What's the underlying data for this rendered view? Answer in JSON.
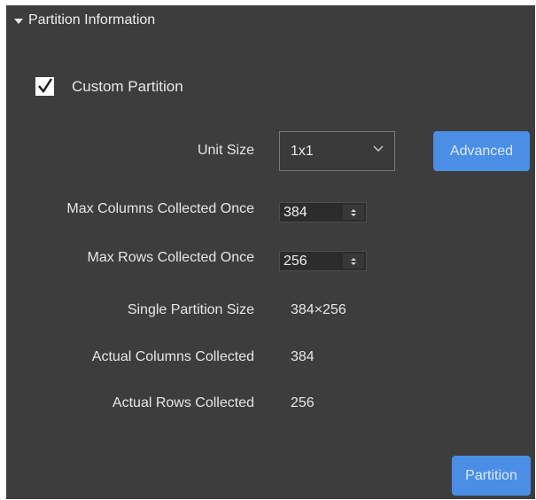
{
  "section": {
    "title": "Partition Information",
    "expanded": true
  },
  "custom_partition": {
    "label": "Custom Partition",
    "checked": true
  },
  "unit_size": {
    "label": "Unit Size",
    "value": "1x1"
  },
  "advanced_button": "Advanced",
  "max_columns": {
    "label": "Max Columns Collected Once",
    "value": "384"
  },
  "max_rows": {
    "label": "Max Rows Collected Once",
    "value": "256"
  },
  "single_partition_size": {
    "label": "Single Partition Size",
    "value": "384×256"
  },
  "actual_columns": {
    "label": "Actual Columns Collected",
    "value": "384"
  },
  "actual_rows": {
    "label": "Actual Rows Collected",
    "value": "256"
  },
  "partition_button": "Partition",
  "colors": {
    "panel_bg": "#3d3d3d",
    "accent": "#4a8ee6",
    "text": "#e6e6e6"
  },
  "icons": [
    "collapse-triangle-icon",
    "checkmark-icon",
    "chevron-down-icon",
    "spinner-arrows-icon"
  ]
}
